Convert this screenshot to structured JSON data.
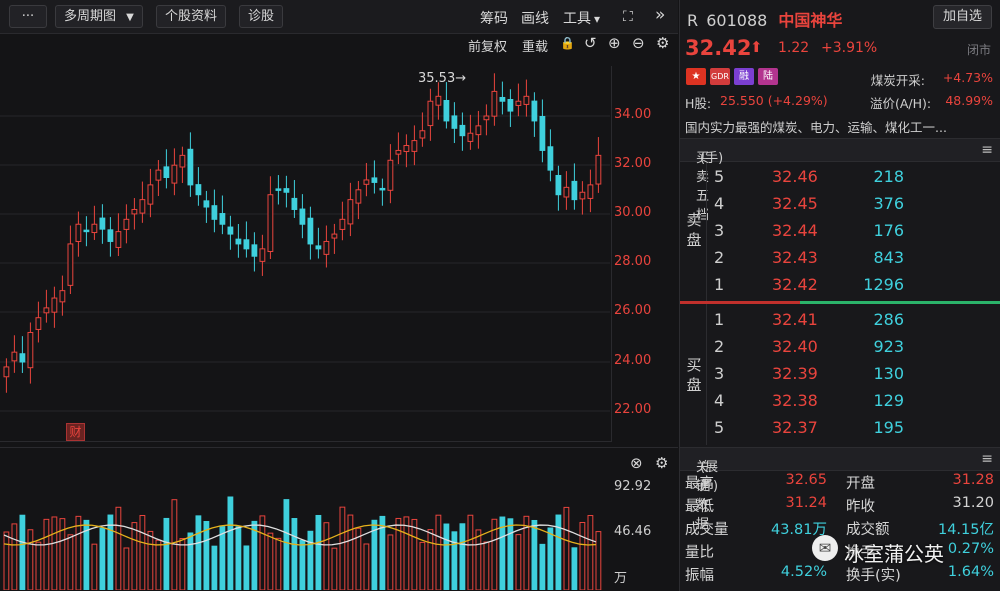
{
  "toolbar": {
    "more": "···",
    "period": "多周期图",
    "period_caret": "▼",
    "profile": "个股资料",
    "diagnose": "诊股",
    "chips": "筹码",
    "draw": "画线",
    "tools": "工具",
    "tools_caret": "▾",
    "fullscreen_icon": "⛶",
    "collapse_icon": "»",
    "adjust_forward": "前复权",
    "overlay": "重载",
    "lock_icon": "🔒",
    "undo_icon": "↺",
    "zoom_in_icon": "⊕",
    "zoom_out_icon": "⊖",
    "settings_icon": "⚙"
  },
  "kline": {
    "high_label": "35.53→",
    "fin_marker": "财",
    "y_ticks": [
      "34.00",
      "32.00",
      "30.00",
      "28.00",
      "26.00",
      "24.00",
      "22.00"
    ]
  },
  "volume": {
    "ticks": [
      "92.92",
      "46.46",
      "万"
    ],
    "close_icon": "⊗",
    "settings_icon": "⚙"
  },
  "quote": {
    "market_prefix": "R",
    "code": "601088",
    "name": "中国神华",
    "add_watch": "加自选",
    "price": "32.42",
    "arrow": "⬆",
    "change": "1.22",
    "change_pct": "+3.91%",
    "status": "闭市",
    "badges": [
      "★",
      "GDR",
      "融",
      "陆"
    ],
    "sector_label": "煤炭开采:",
    "sector_pct": "+4.73%",
    "h_label": "H股:",
    "h_value": "25.550 (+4.29%)",
    "premium_label": "溢价(A/H):",
    "premium_value": "48.99%",
    "description": "国内实力最强的煤炭、电力、运输、煤化工一...",
    "colors": {
      "up": "#e9443d",
      "down": "#3fd0dd"
    }
  },
  "orderbook": {
    "title": "买卖五档",
    "unit": "(手)",
    "menu_icon": "≡",
    "sell_label": "卖盘",
    "buy_label": "买盘",
    "sell": [
      {
        "level": "5",
        "price": "32.46",
        "volume": "218"
      },
      {
        "level": "4",
        "price": "32.45",
        "volume": "376"
      },
      {
        "level": "3",
        "price": "32.44",
        "volume": "176"
      },
      {
        "level": "2",
        "price": "32.43",
        "volume": "843"
      },
      {
        "level": "1",
        "price": "32.42",
        "volume": "1296"
      }
    ],
    "buy": [
      {
        "level": "1",
        "price": "32.41",
        "volume": "286"
      },
      {
        "level": "2",
        "price": "32.40",
        "volume": "923"
      },
      {
        "level": "3",
        "price": "32.39",
        "volume": "130"
      },
      {
        "level": "4",
        "price": "32.38",
        "volume": "129"
      },
      {
        "level": "5",
        "price": "32.37",
        "volume": "195"
      }
    ]
  },
  "keydata": {
    "title": "关键数据",
    "expand": "(展开)",
    "menu_icon": "≡",
    "rows": [
      {
        "l1": "最高",
        "v1": "32.65",
        "c1": "red",
        "l2": "开盘",
        "v2": "31.28",
        "c2": "red"
      },
      {
        "l1": "最低",
        "v1": "31.24",
        "c1": "red",
        "l2": "昨收",
        "v2": "31.20",
        "c2": "white"
      },
      {
        "l1": "成交量",
        "v1": "43.81万",
        "c1": "cyan",
        "l2": "成交额",
        "v2": "14.15亿",
        "c2": "cyan"
      },
      {
        "l1": "量比",
        "v1": "",
        "c1": "white",
        "l2": "换手",
        "v2": "0.27%",
        "c2": "cyan"
      },
      {
        "l1": "振幅",
        "v1": "4.52%",
        "c1": "cyan",
        "l2": "换手(实)",
        "v2": "1.64%",
        "c2": "cyan"
      }
    ]
  },
  "watermark": {
    "logo": "✉",
    "text": "冰室蒲公英"
  }
}
